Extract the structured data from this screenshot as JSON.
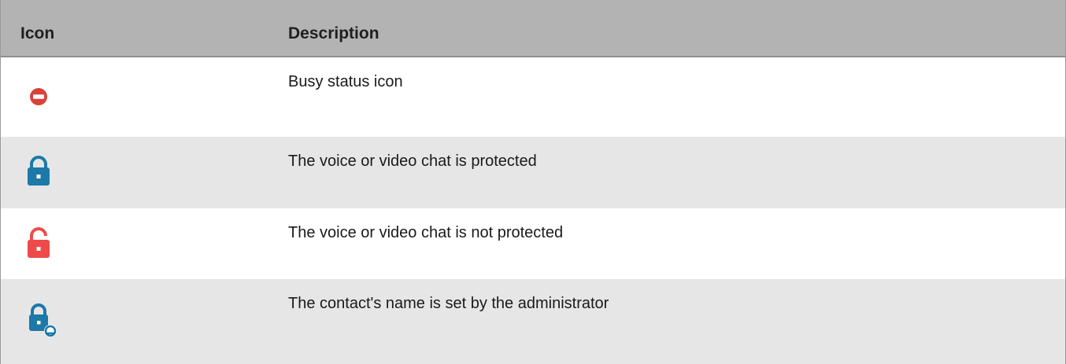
{
  "table": {
    "headers": {
      "icon": "Icon",
      "description": "Description"
    },
    "rows": [
      {
        "icon": "busy-status-icon",
        "description": "Busy status icon",
        "icon_color": "#d9413b"
      },
      {
        "icon": "lock-protected-icon",
        "description": "The voice or video chat is protected",
        "icon_color": "#1c79a8"
      },
      {
        "icon": "lock-unprotected-icon",
        "description": "The voice or video chat is not protected",
        "icon_color": "#ee4a4a"
      },
      {
        "icon": "lock-admin-contact-icon",
        "description": "The contact's name is set by the administrator",
        "icon_color": "#1c79a8"
      }
    ]
  },
  "colors": {
    "header_bg": "#b3b3b3",
    "row_alt_bg": "#e6e6e6",
    "row_bg": "#ffffff"
  }
}
